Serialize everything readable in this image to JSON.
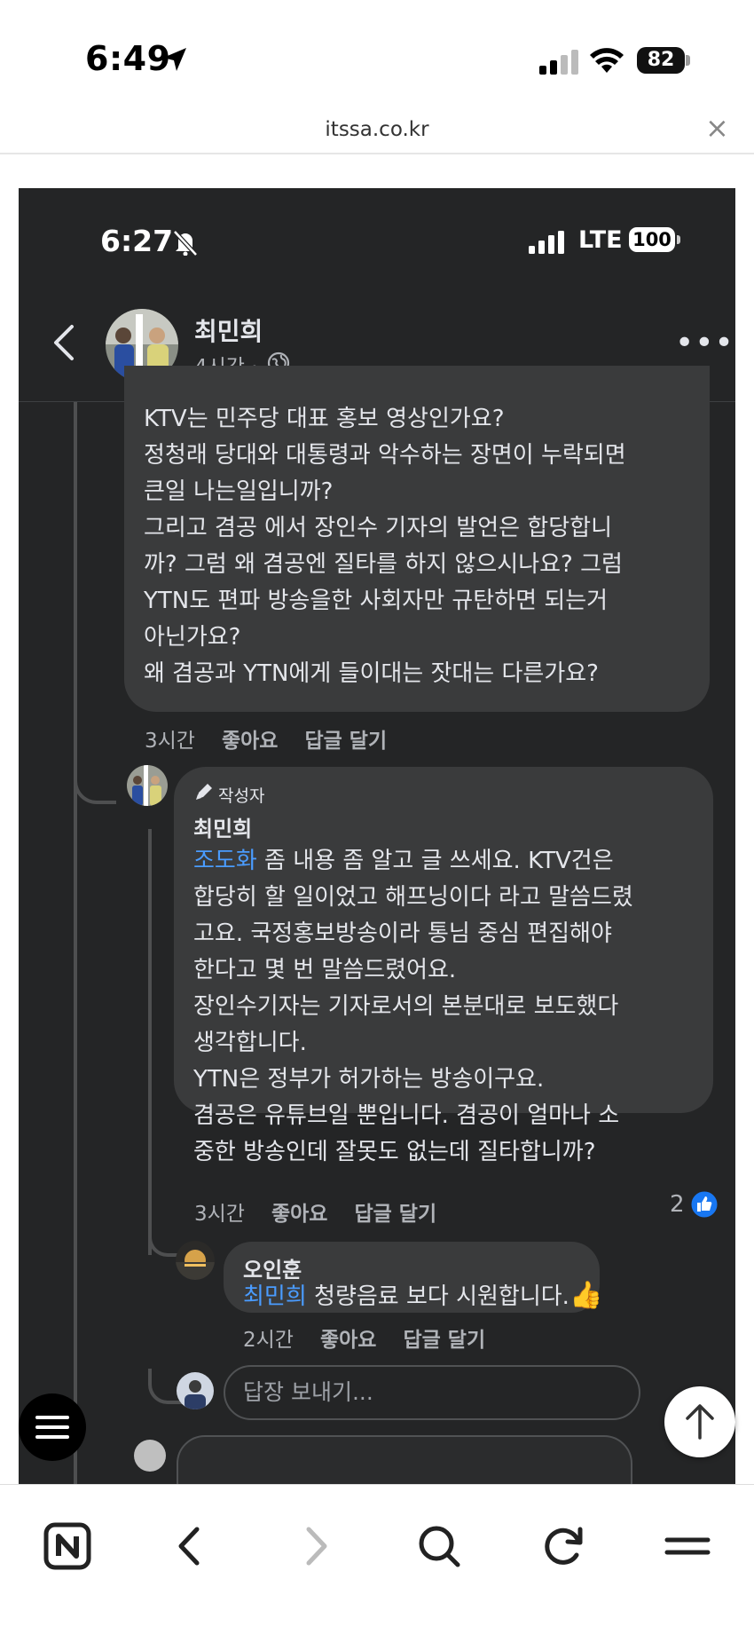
{
  "os_status": {
    "time": "6:49",
    "battery": "82"
  },
  "browser": {
    "url": "itssa.co.kr",
    "close": "×"
  },
  "inner_status": {
    "time": "6:27",
    "network": "LTE",
    "battery": "100"
  },
  "post_header": {
    "name": "최민희",
    "time": "4시간 ·"
  },
  "comments": [
    {
      "text": "KTV는 민주당 대표 홍보 영상인가요?\n정청래 당대와 대통령과 악수하는 장면이 누락되면\n큰일 나는일입니까?\n그리고 겸공 에서 장인수 기자의 발언은 합당합니\n까? 그럼 왜 겸공엔 질타를 하지 않으시나요? 그럼\nYTN도 편파 방송을한 사회자만 규탄하면 되는거\n아닌가요?\n왜 겸공과 YTN에게 들이대는 잣대는 다른가요?",
      "time": "3시간",
      "like": "좋아요",
      "reply": "답글 달기"
    },
    {
      "badge": "작성자",
      "author": "최민희",
      "mention": "조도화",
      "text": " 좀 내용 좀 알고 글 쓰세요. KTV건은\n합당히 할 일이었고 해프닝이다 라고 말씀드렸\n고요. 국정홍보방송이라 통님 중심 편집해야\n한다고 몇 번 말씀드렸어요.\n장인수기자는 기자로서의 본분대로 보도했다\n생각합니다.\nYTN은 정부가 허가하는 방송이구요.\n겸공은 유튜브일 뿐입니다. 겸공이 얼마나 소\n중한 방송인데 잘못도 없는데 질타합니까?",
      "time": "3시간",
      "like": "좋아요",
      "reply": "답글 달기",
      "reactions": "2"
    },
    {
      "author": "오인훈",
      "mention": "최민희",
      "text": " 청량음료 보다 시원합니다.",
      "emoji": "👍",
      "time": "2시간",
      "like": "좋아요",
      "reply": "답글 달기"
    }
  ],
  "reply_input": {
    "placeholder": "답장 보내기..."
  },
  "toolbar_icons": [
    "naver-icon",
    "back-icon",
    "forward-icon",
    "search-icon",
    "reload-icon",
    "menu-icon"
  ]
}
